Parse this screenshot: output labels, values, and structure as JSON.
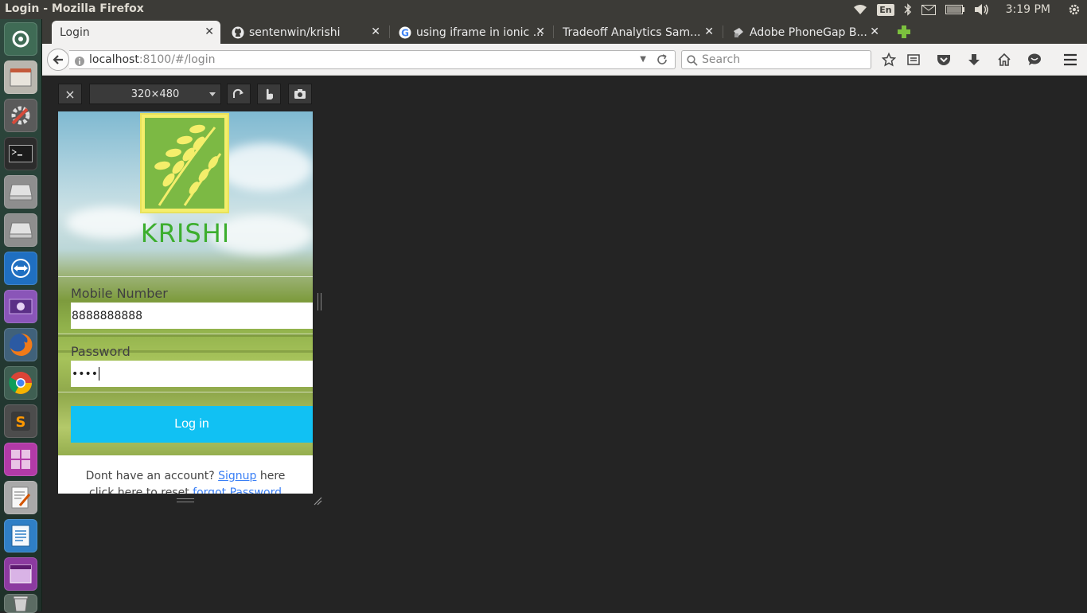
{
  "os_panel": {
    "window_title": "Login - Mozilla Firefox",
    "language": "En",
    "clock": "3:19 PM"
  },
  "launcher": {
    "items": [
      "dash-home",
      "files",
      "system-settings",
      "terminal",
      "disk-drive",
      "disk-drive-2",
      "teamviewer",
      "screen-recorder",
      "firefox",
      "chrome",
      "sublime-text",
      "workspace-switcher",
      "text-editor",
      "libreoffice-writer",
      "app-window",
      "trash"
    ]
  },
  "browser": {
    "tabs": [
      {
        "label": "Login",
        "active": true
      },
      {
        "label": "sentenwin/krishi",
        "active": false
      },
      {
        "label": "using iframe in ionic ...",
        "active": false
      },
      {
        "label": "Tradeoff Analytics Sam...",
        "active": false
      },
      {
        "label": "Adobe PhoneGap B...",
        "active": false
      }
    ],
    "url_host": "localhost",
    "url_rest": ":8100/#/login",
    "search_placeholder": "Search"
  },
  "rdm": {
    "close": "×",
    "size": "320×480"
  },
  "app": {
    "logo_text": "KRISHI",
    "mobile_label": "Mobile Number",
    "mobile_value": "8888888888",
    "password_label": "Password",
    "password_value": "••••",
    "login_button": "Log in",
    "no_account_text": "Dont have an account?",
    "signup_link": "Signup",
    "signup_suffix": "here",
    "reset_text": "click here to reset",
    "forgot_link": "forgot Password"
  },
  "colors": {
    "login_button": "#11c1f3",
    "logo_green": "#3cae2e",
    "logo_bg": "#7cb944",
    "logo_border": "#f4ee6b",
    "link": "#387ef5"
  }
}
